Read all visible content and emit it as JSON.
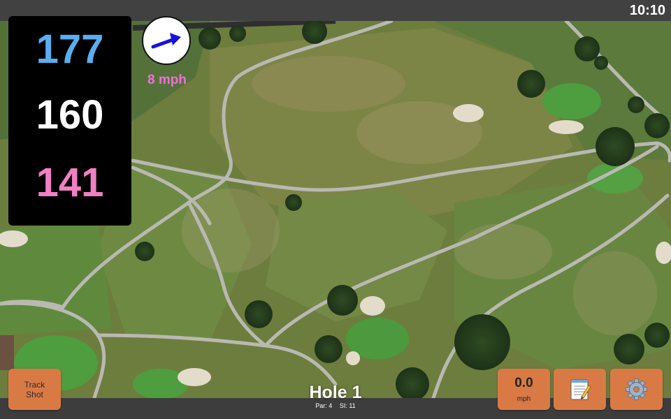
{
  "status": {
    "clock": "10:10"
  },
  "distances": {
    "back": "177",
    "center": "160",
    "front": "141",
    "colors": {
      "back": "#5aaef0",
      "center": "#ffffff",
      "front": "#f07fc4"
    }
  },
  "wind": {
    "speed_label": "8 mph",
    "arrow_color": "#1414d8",
    "icon": "wind-direction-arrow"
  },
  "track_shot": {
    "line1": "Track",
    "line2": "Shot"
  },
  "hole": {
    "title": "Hole 1",
    "par": "Par: 4",
    "si": "SI: 11"
  },
  "speed": {
    "value": "0.0",
    "unit": "mph"
  },
  "buttons": {
    "notes_icon": "notepad-icon",
    "settings_icon": "gear-icon",
    "accent": "#d97a45"
  }
}
